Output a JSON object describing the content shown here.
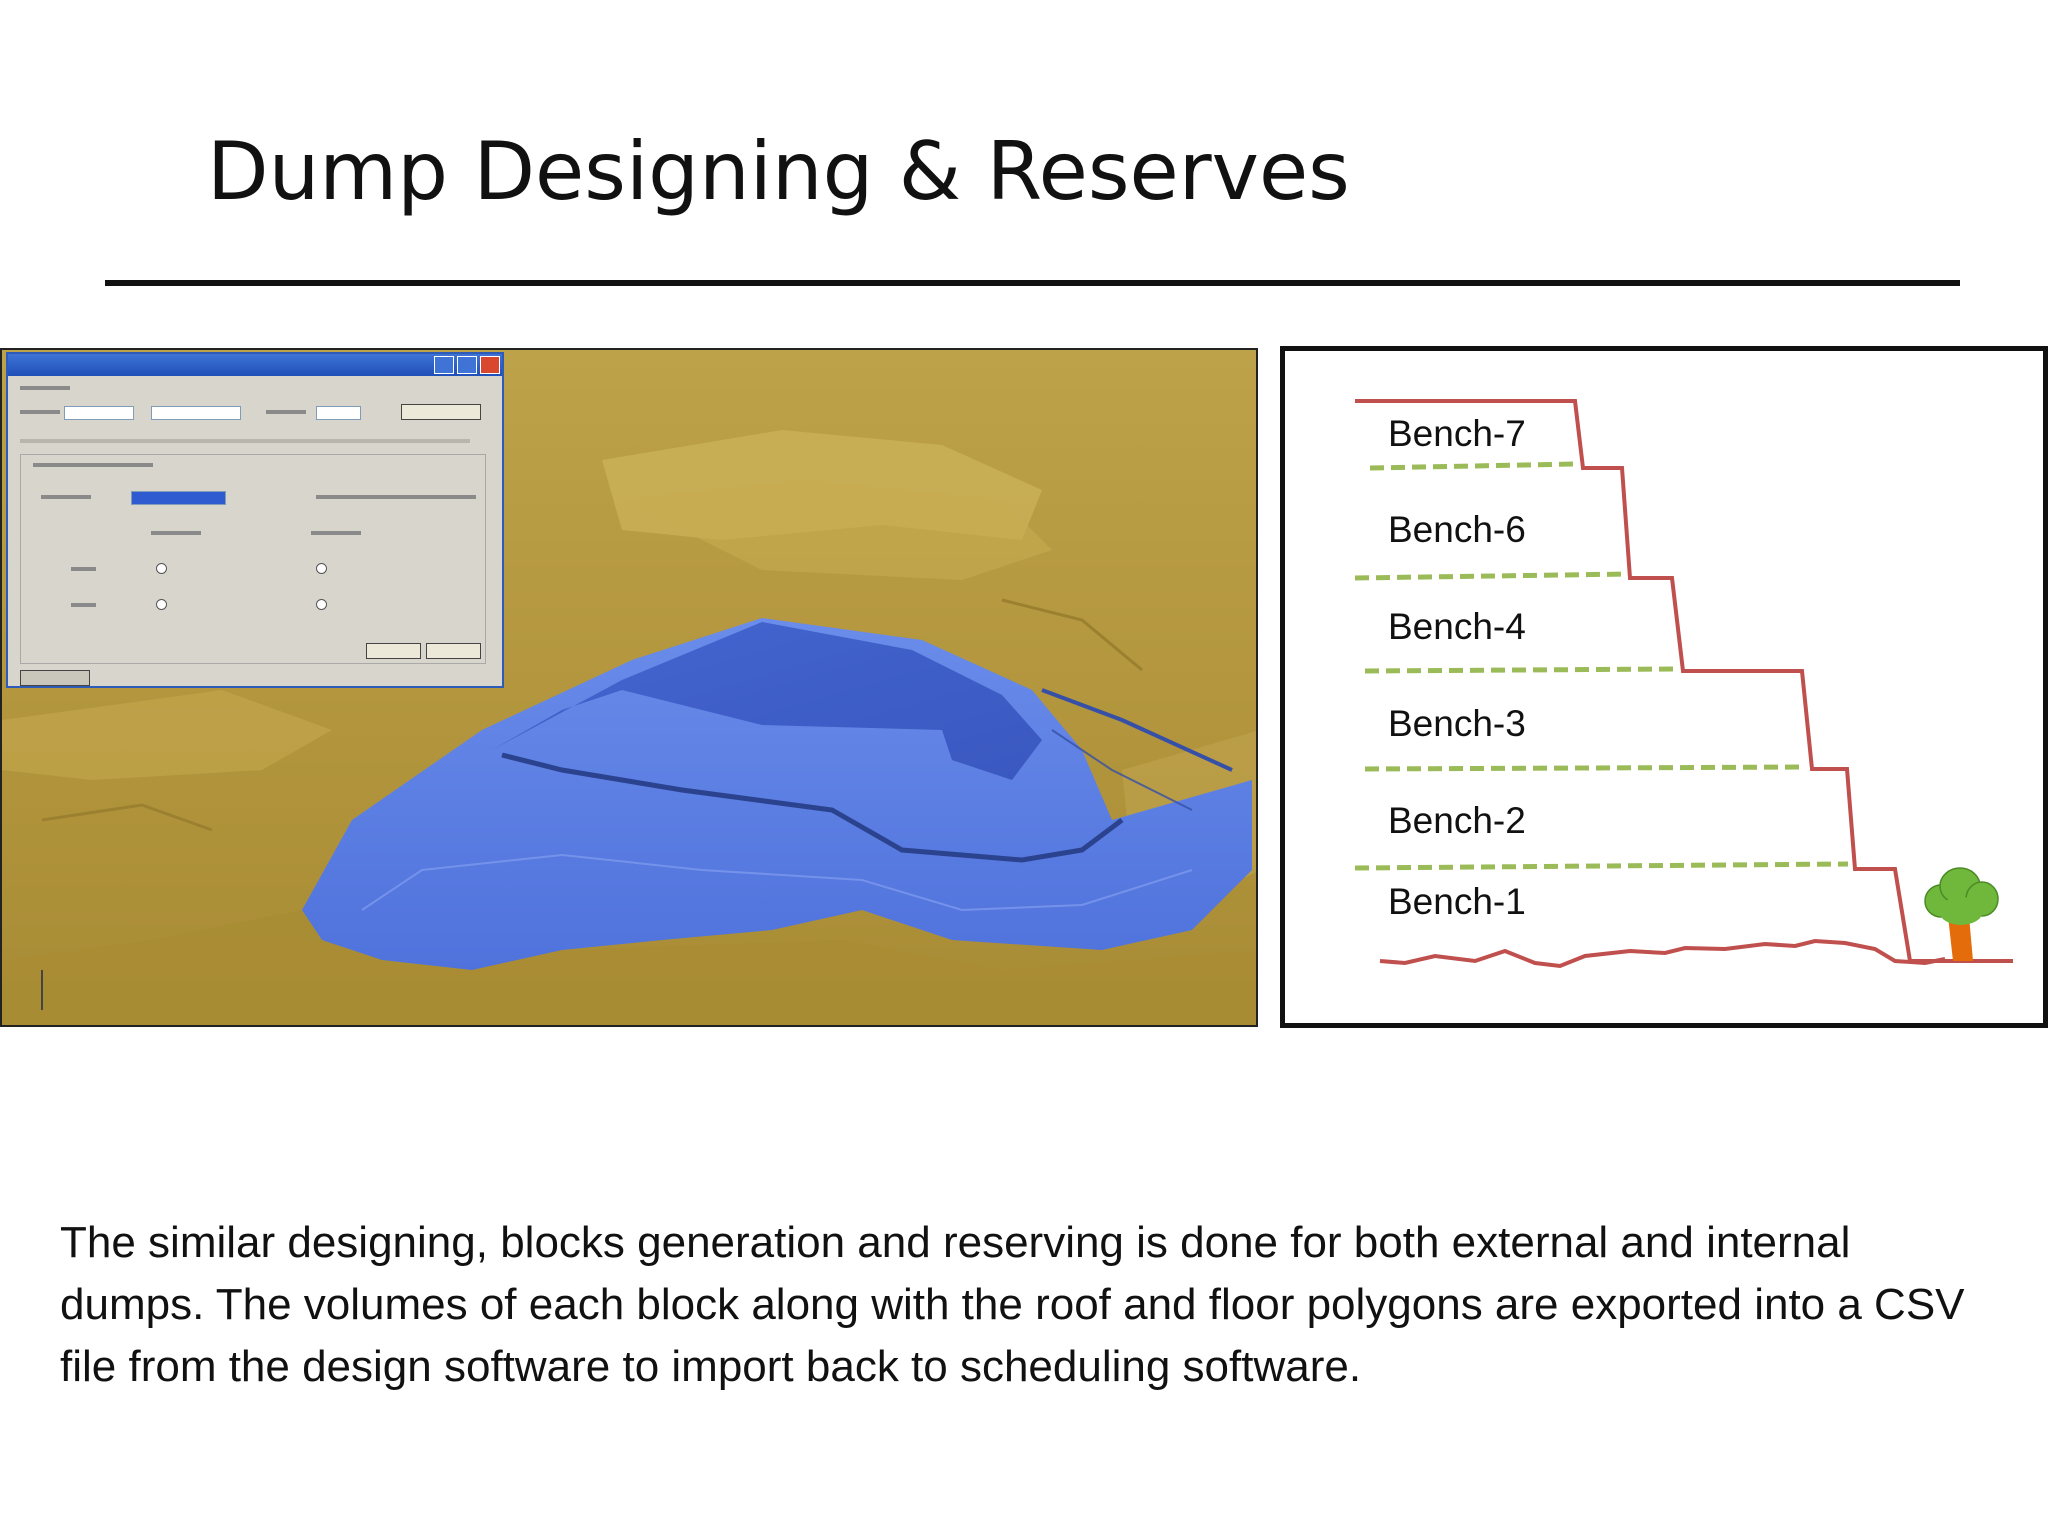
{
  "slide": {
    "title": "Dump Designing & Reserves",
    "body": "The similar designing, blocks generation and reserving is done for both external and internal dumps. The volumes of each block along with the roof and floor polygons  are exported into a CSV file from the design software to import back to scheduling software."
  },
  "diagram": {
    "benches": [
      "Bench-7",
      "Bench-6",
      "Bench-4",
      "Bench-3",
      "Bench-2",
      "Bench-1"
    ],
    "colors": {
      "profile": "#c0504d",
      "bench_divider": "#9bbb59",
      "tree_crown": "#6fb83b",
      "tree_trunk": "#e46c0a"
    }
  },
  "scene": {
    "colors": {
      "terrain": "#b5983f",
      "dump": "#5b7ee0",
      "dump_dark": "#3b5cc4"
    }
  }
}
